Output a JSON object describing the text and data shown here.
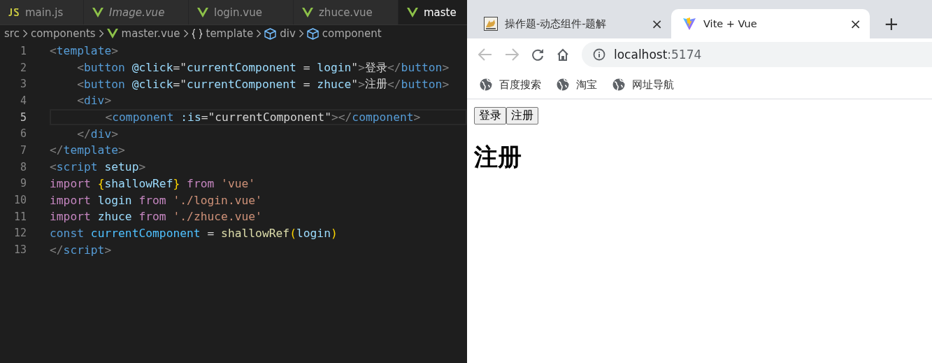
{
  "editor": {
    "tabs": [
      {
        "label": "main.js",
        "kind": "js",
        "preview": false,
        "selected": false
      },
      {
        "label": "Image.vue",
        "kind": "vue",
        "preview": true,
        "selected": false
      },
      {
        "label": "login.vue",
        "kind": "vue",
        "preview": false,
        "selected": false
      },
      {
        "label": "zhuce.vue",
        "kind": "vue",
        "preview": false,
        "selected": false
      },
      {
        "label": "maste",
        "kind": "vue",
        "preview": false,
        "selected": true
      }
    ],
    "breadcrumb": [
      {
        "label": "src",
        "kind": "folder"
      },
      {
        "label": "components",
        "kind": "folder"
      },
      {
        "label": "master.vue",
        "kind": "vue"
      },
      {
        "label": "template",
        "kind": "braces"
      },
      {
        "label": "div",
        "kind": "element"
      },
      {
        "label": "component",
        "kind": "element"
      }
    ],
    "lines": [
      {
        "number": "1",
        "active": false,
        "tokens": [
          {
            "kind": "punct",
            "text": "<"
          },
          {
            "kind": "tag",
            "text": "template"
          },
          {
            "kind": "punct",
            "text": ">"
          }
        ]
      },
      {
        "number": "2",
        "active": false,
        "tokens": [
          {
            "kind": "punct",
            "text": "    <"
          },
          {
            "kind": "tag",
            "text": "button"
          },
          {
            "kind": "attr",
            "text": " @click"
          },
          {
            "kind": "plain",
            "text": "=\""
          },
          {
            "kind": "var",
            "text": "currentComponent"
          },
          {
            "kind": "plain",
            "text": " = "
          },
          {
            "kind": "var",
            "text": "login"
          },
          {
            "kind": "plain",
            "text": "\""
          },
          {
            "kind": "punct",
            "text": ">"
          },
          {
            "kind": "plain",
            "text": "登录"
          },
          {
            "kind": "punct",
            "text": "</"
          },
          {
            "kind": "tag",
            "text": "button"
          },
          {
            "kind": "punct",
            "text": ">"
          }
        ]
      },
      {
        "number": "3",
        "active": false,
        "tokens": [
          {
            "kind": "punct",
            "text": "    <"
          },
          {
            "kind": "tag",
            "text": "button"
          },
          {
            "kind": "attr",
            "text": " @click"
          },
          {
            "kind": "plain",
            "text": "=\""
          },
          {
            "kind": "var",
            "text": "currentComponent"
          },
          {
            "kind": "plain",
            "text": " = "
          },
          {
            "kind": "var",
            "text": "zhuce"
          },
          {
            "kind": "plain",
            "text": "\""
          },
          {
            "kind": "punct",
            "text": ">"
          },
          {
            "kind": "plain",
            "text": "注册"
          },
          {
            "kind": "punct",
            "text": "</"
          },
          {
            "kind": "tag",
            "text": "button"
          },
          {
            "kind": "punct",
            "text": ">"
          }
        ]
      },
      {
        "number": "4",
        "active": false,
        "tokens": [
          {
            "kind": "punct",
            "text": "    <"
          },
          {
            "kind": "tag",
            "text": "div"
          },
          {
            "kind": "punct",
            "text": ">"
          }
        ]
      },
      {
        "number": "5",
        "active": true,
        "tokens": [
          {
            "kind": "punct",
            "text": "        <"
          },
          {
            "kind": "tag",
            "text": "component"
          },
          {
            "kind": "attr",
            "text": " :is"
          },
          {
            "kind": "plain",
            "text": "=\"currentComponent\""
          },
          {
            "kind": "punct",
            "text": "></"
          },
          {
            "kind": "tag",
            "text": "component"
          },
          {
            "kind": "punct",
            "text": ">"
          }
        ]
      },
      {
        "number": "6",
        "active": false,
        "tokens": [
          {
            "kind": "punct",
            "text": "    </"
          },
          {
            "kind": "tag",
            "text": "div"
          },
          {
            "kind": "punct",
            "text": ">"
          }
        ]
      },
      {
        "number": "7",
        "active": false,
        "tokens": [
          {
            "kind": "punct",
            "text": "</"
          },
          {
            "kind": "tag",
            "text": "template"
          },
          {
            "kind": "punct",
            "text": ">"
          }
        ]
      },
      {
        "number": "8",
        "active": false,
        "tokens": [
          {
            "kind": "punct",
            "text": "<"
          },
          {
            "kind": "tag",
            "text": "script"
          },
          {
            "kind": "var",
            "text": " setup"
          },
          {
            "kind": "punct",
            "text": ">"
          }
        ]
      },
      {
        "number": "9",
        "active": false,
        "tokens": [
          {
            "kind": "keyword",
            "text": "import "
          },
          {
            "kind": "brace",
            "text": "{"
          },
          {
            "kind": "var",
            "text": "shallowRef"
          },
          {
            "kind": "brace",
            "text": "}"
          },
          {
            "kind": "keyword",
            "text": " from "
          },
          {
            "kind": "string",
            "text": "'vue'"
          }
        ]
      },
      {
        "number": "10",
        "active": false,
        "tokens": [
          {
            "kind": "keyword",
            "text": "import "
          },
          {
            "kind": "var",
            "text": "login"
          },
          {
            "kind": "keyword",
            "text": " from "
          },
          {
            "kind": "string",
            "text": "'./login.vue'"
          }
        ]
      },
      {
        "number": "11",
        "active": false,
        "tokens": [
          {
            "kind": "keyword",
            "text": "import "
          },
          {
            "kind": "var",
            "text": "zhuce"
          },
          {
            "kind": "keyword",
            "text": " from "
          },
          {
            "kind": "string",
            "text": "'./zhuce.vue'"
          }
        ]
      },
      {
        "number": "12",
        "active": false,
        "tokens": [
          {
            "kind": "tag",
            "text": "const "
          },
          {
            "kind": "const",
            "text": "currentComponent"
          },
          {
            "kind": "plain",
            "text": " = "
          },
          {
            "kind": "fn",
            "text": "shallowRef"
          },
          {
            "kind": "brace",
            "text": "("
          },
          {
            "kind": "var",
            "text": "login"
          },
          {
            "kind": "brace",
            "text": ")"
          }
        ]
      },
      {
        "number": "13",
        "active": false,
        "tokens": [
          {
            "kind": "punct",
            "text": "</"
          },
          {
            "kind": "tag",
            "text": "script"
          },
          {
            "kind": "punct",
            "text": ">"
          }
        ]
      }
    ]
  },
  "browser": {
    "tabs": [
      {
        "title": "操作题-动态组件-题解",
        "kind": "image",
        "close": "×",
        "selected": false
      },
      {
        "title": "Vite + Vue",
        "kind": "vite",
        "close": "×",
        "selected": true
      }
    ],
    "new_tab": "+",
    "address": {
      "host": "localhost",
      "port": ":5174"
    },
    "bookmarks": [
      {
        "label": "百度搜索"
      },
      {
        "label": "淘宝"
      },
      {
        "label": "网址导航"
      }
    ],
    "page": {
      "buttons": [
        "登录",
        "注册"
      ],
      "heading": "注册"
    }
  }
}
